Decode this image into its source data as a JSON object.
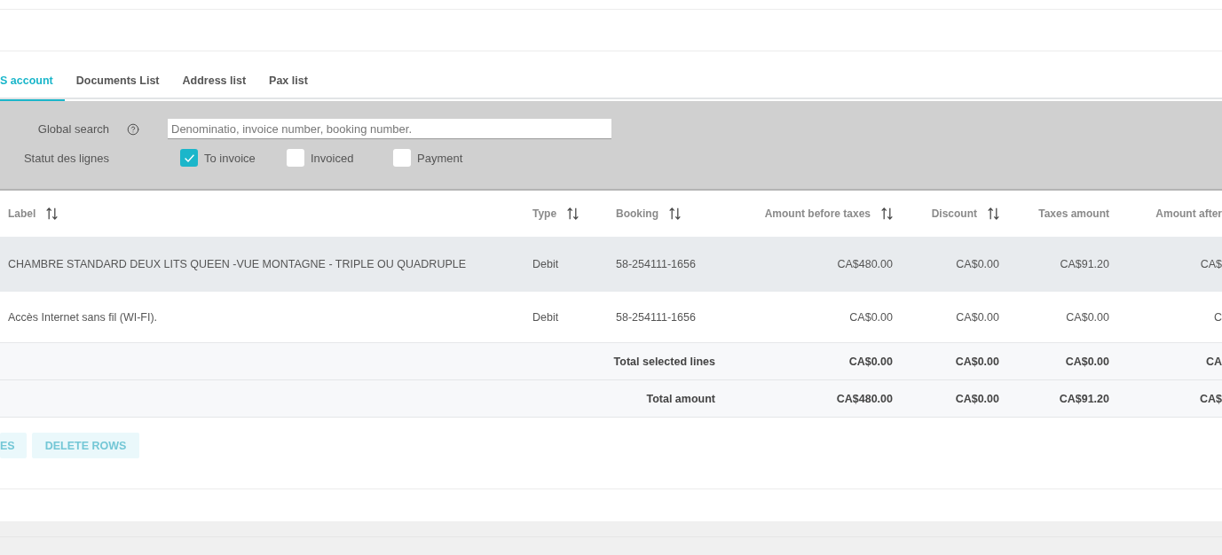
{
  "tabs": [
    {
      "label": "S account",
      "selected": true
    },
    {
      "label": "Documents List",
      "selected": false
    },
    {
      "label": "Address list",
      "selected": false
    },
    {
      "label": "Pax list",
      "selected": false
    }
  ],
  "filters": {
    "search": {
      "label": "Global search",
      "placeholder": "Denominatio, invoice number, booking number."
    },
    "line_status": {
      "label": "Statut des lignes",
      "options": [
        {
          "label": "To invoice",
          "checked": true
        },
        {
          "label": "Invoiced",
          "checked": false
        },
        {
          "label": "Payment",
          "checked": false
        }
      ]
    }
  },
  "table": {
    "columns": [
      {
        "label": "Label",
        "sortable": true
      },
      {
        "label": "Type",
        "sortable": true
      },
      {
        "label": "Booking",
        "sortable": true
      },
      {
        "label": "Amount before taxes",
        "sortable": true
      },
      {
        "label": "Discount",
        "sortable": true
      },
      {
        "label": "Taxes amount",
        "sortable": false
      },
      {
        "label": "Amount after",
        "sortable": false
      }
    ],
    "rows": [
      {
        "hovered": true,
        "cells": [
          "CHAMBRE STANDARD DEUX LITS QUEEN -VUE MONTAGNE - TRIPLE OU QUADRUPLE",
          "Debit",
          "58-254111-1656",
          "CA$480.00",
          "CA$0.00",
          "CA$91.20",
          "CA$"
        ]
      },
      {
        "hovered": false,
        "cells": [
          "Accès Internet sans fil (WI-FI).",
          "Debit",
          "58-254111-1656",
          "CA$0.00",
          "CA$0.00",
          "CA$0.00",
          "C"
        ]
      }
    ],
    "totals": [
      {
        "label": "Total selected lines",
        "values": [
          "CA$0.00",
          "CA$0.00",
          "CA$0.00",
          "CA"
        ]
      },
      {
        "label": "Total amount",
        "values": [
          "CA$480.00",
          "CA$0.00",
          "CA$91.20",
          "CA$"
        ]
      }
    ]
  },
  "buttons": [
    {
      "label": "ES",
      "disabled": true
    },
    {
      "label": "DELETE ROWS",
      "disabled": true
    }
  ]
}
